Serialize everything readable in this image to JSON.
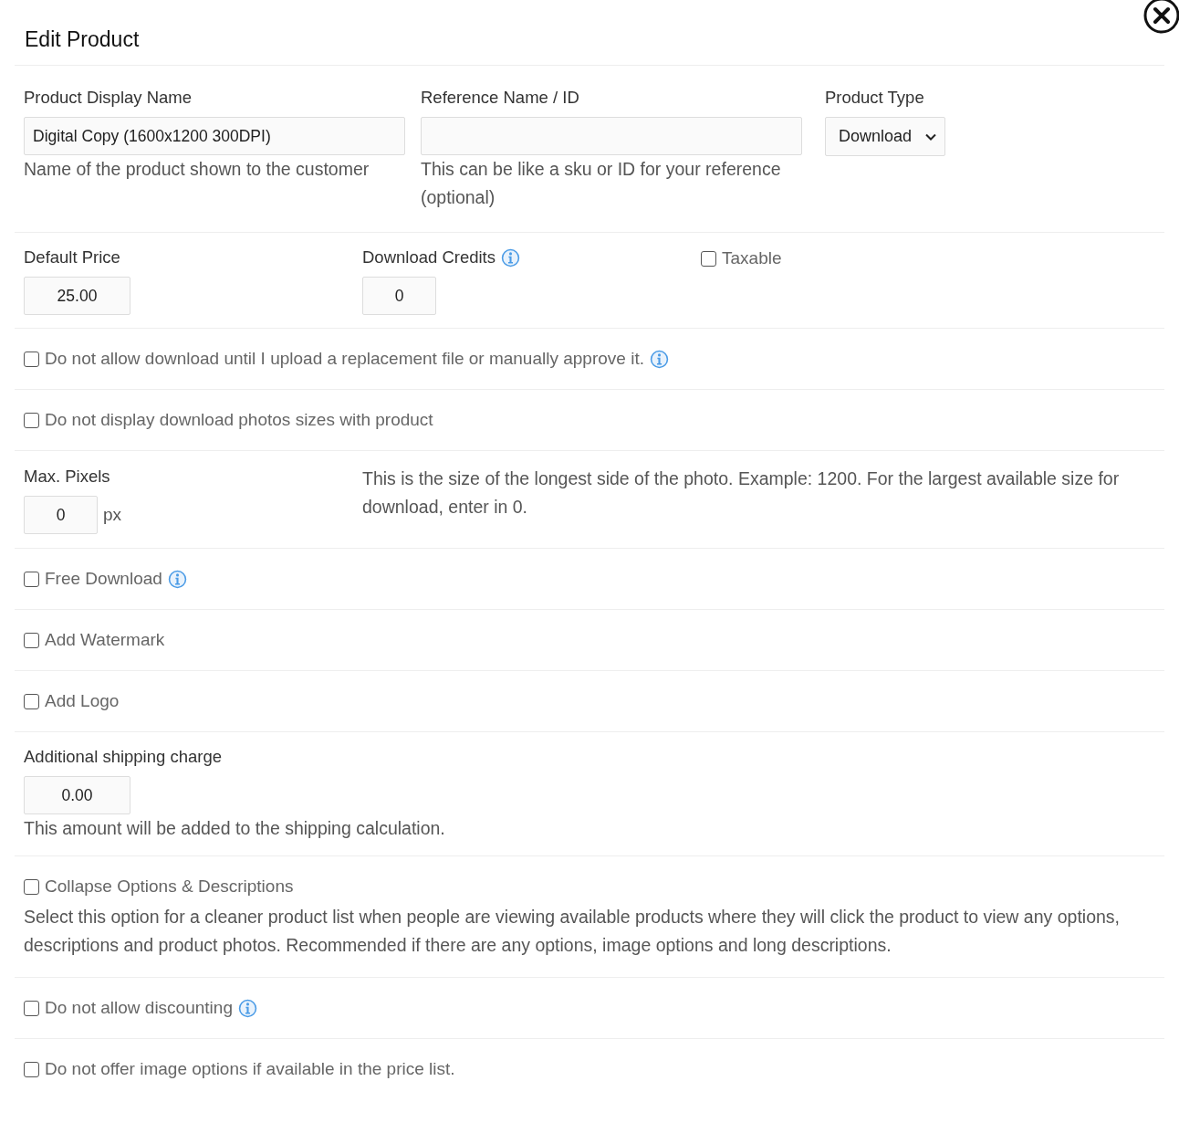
{
  "dialog": {
    "title": "Edit Product"
  },
  "sections": [
    {
      "kind": "names",
      "name_field": {
        "label": "Product Display Name",
        "value": "Digital Copy (1600x1200 300DPI)",
        "help": "Name of the product shown to the customer"
      },
      "ref_field": {
        "label": "Reference Name / ID",
        "help": "This can be like a sku or ID for your reference (optional)"
      },
      "type_select": {
        "label": "Product Type",
        "value": "Download"
      }
    },
    {
      "kind": "price",
      "price": {
        "label": "Default Price",
        "value": "25.00"
      },
      "credits": {
        "label": "Download Credits",
        "value": "0",
        "info": true
      },
      "taxable": {
        "label": "Taxable",
        "checked": false
      }
    },
    {
      "kind": "checkbox",
      "label": "Do not allow download until I upload a replacement file or manually approve it.",
      "checked": false,
      "info": true
    },
    {
      "kind": "checkbox",
      "label": "Do not display download photos sizes with product",
      "checked": false,
      "info": false
    },
    {
      "kind": "pixels",
      "label": "Max. Pixels",
      "value": "0",
      "unit": "px",
      "help": "This is the size of the longest side of the photo. Example: 1200. For the largest available size for download, enter in 0."
    },
    {
      "kind": "checkbox",
      "label": "Free Download",
      "checked": false,
      "info": true
    },
    {
      "kind": "checkbox",
      "label": "Add Watermark",
      "checked": false,
      "info": false
    },
    {
      "kind": "checkbox",
      "label": "Add Logo",
      "checked": false,
      "info": false
    },
    {
      "kind": "shipping",
      "label": "Additional shipping charge",
      "value": "0.00",
      "help": "This amount will be added to the shipping calculation."
    },
    {
      "kind": "checkbox",
      "label": "Collapse Options & Descriptions",
      "checked": false,
      "info": false,
      "help": "Select this option for a cleaner product list when people are viewing available products where they will click the product to view any options, descriptions and product photos. Recommended if there are any options, image options and long descriptions."
    },
    {
      "kind": "checkbox",
      "label": "Do not allow discounting",
      "checked": false,
      "info": true
    },
    {
      "kind": "checkbox",
      "label": "Do not offer image options if available in the price list.",
      "checked": false,
      "info": false
    }
  ]
}
